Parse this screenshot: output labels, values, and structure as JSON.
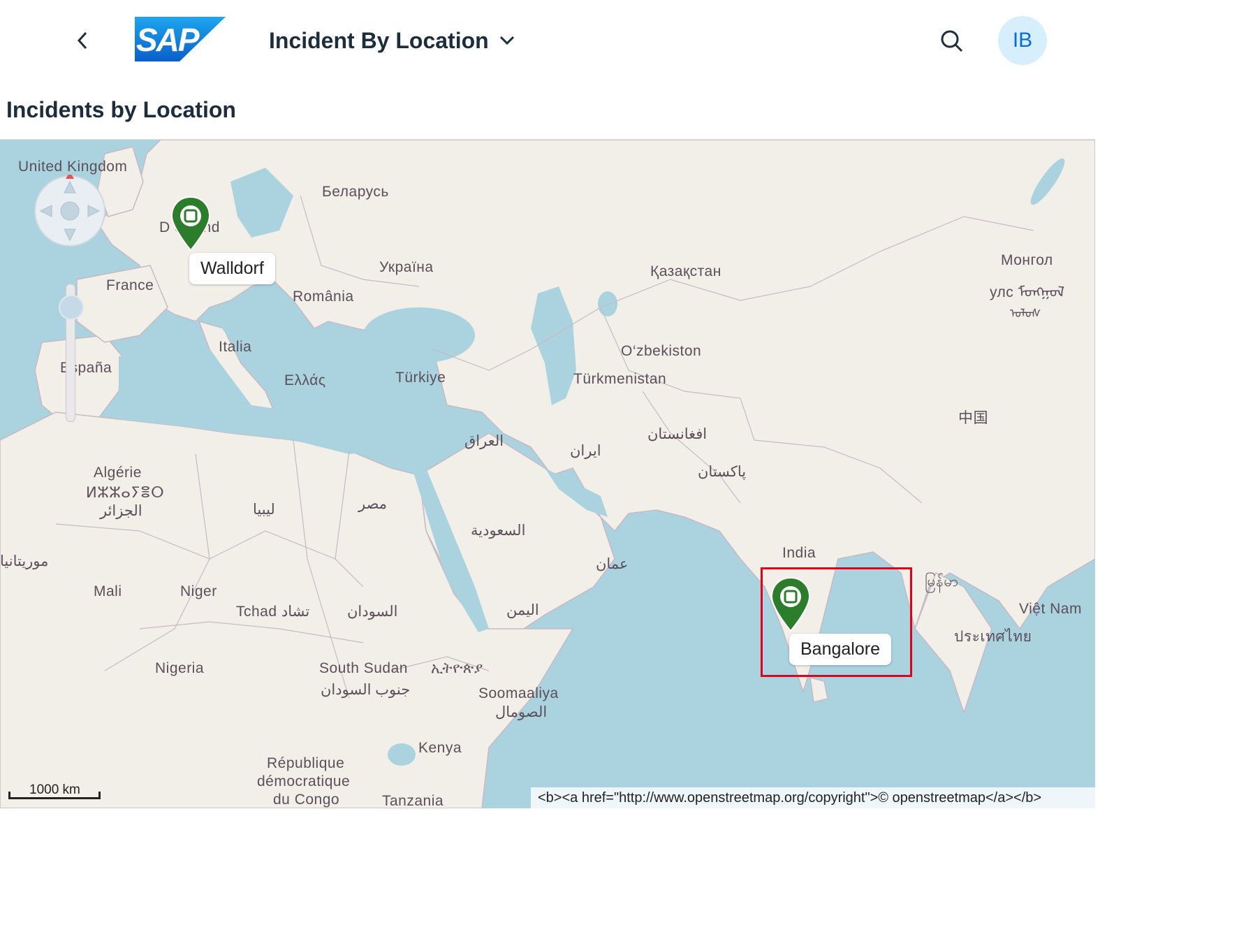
{
  "shell": {
    "logo_text": "SAP",
    "app_title": "Incident By Location",
    "avatar_initials": "IB",
    "brand_color": "#0a6ed1"
  },
  "page": {
    "title": "Incidents by Location"
  },
  "map": {
    "country_labels": {
      "united_kingdom": "United Kingdom",
      "deutschland": "D      chland",
      "belarus": "Беларусь",
      "ukraine": "Україна",
      "france": "France",
      "romania": "România",
      "italia": "Italia",
      "espana": "España",
      "hellas": "Ελλάς",
      "turkiye": "Türkiye",
      "kazakhstan": "Қазақстан",
      "mongolia_1": "Монгол",
      "mongolia_2": "улс ᠮᠣᠩᠭᠣᠯ",
      "mongolia_3": "ᠤᠯᠤᠰ",
      "uzbekistan": "O‘zbekiston",
      "turkmenistan": "Türkmenistan",
      "china": "中国",
      "afghanistan": "افغانستان",
      "iraq": "العراق",
      "iran": "ایران",
      "pakistan": "پاکستان",
      "algeria_1": "Algérie",
      "algeria_2": "ⵍⵣⵣⴰⵢⴻⵔ",
      "algeria_3": "الجزائر",
      "libya": "ليبيا",
      "egypt": "مصر",
      "saudi": "السعودية",
      "oman": "عمان",
      "india": "India",
      "myanmar": "မြန်မာ",
      "vietnam": "Việt Nam",
      "thailand": "ประเทศไทย",
      "mauritania": "موريتانيا",
      "mali": "Mali",
      "niger": "Niger",
      "chad": "Tchad تشاد",
      "sudan": "السودان",
      "yemen": "اليمن",
      "nigeria": "Nigeria",
      "south_sudan_1": "South Sudan",
      "south_sudan_2": "جنوب السودان",
      "ethiopia": "ኢትዮጵያ",
      "somalia_1": "Soomaaliya",
      "somalia_2": "الصومال",
      "kenya": "Kenya",
      "drc_1": "République",
      "drc_2": "démocratique",
      "drc_3": "du Congo",
      "tanzania": "Tanzania"
    },
    "markers": [
      {
        "label": "Walldorf",
        "color": "#2b7d2b"
      },
      {
        "label": "Bangalore",
        "color": "#2b7d2b"
      }
    ],
    "scale_label": "1000 km",
    "attribution": "<b><a href=\"http://www.openstreetmap.org/copyright\">© openstreetmap</a></b>",
    "highlight_color": "#e2001a",
    "water_color": "#aad3df",
    "land_color": "#f2efe9"
  }
}
